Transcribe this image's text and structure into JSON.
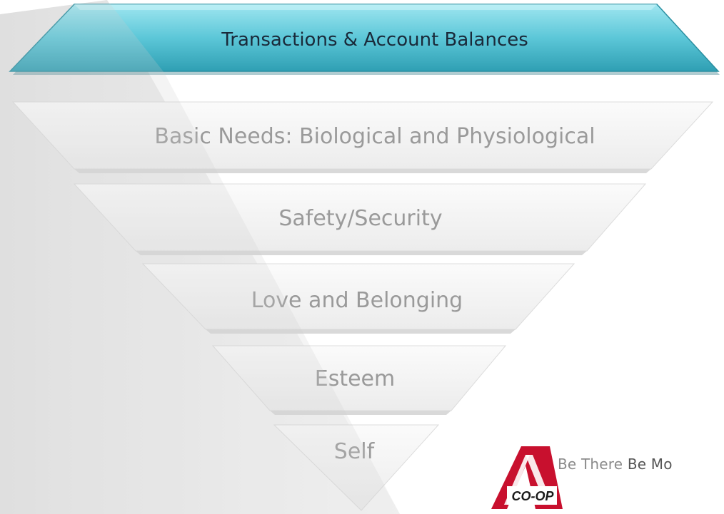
{
  "header": {
    "title": "Transactions & Account Balances",
    "fill": "#5cc7d8",
    "text_color": "#1a2a3a"
  },
  "pyramid": {
    "tiers": [
      {
        "label": "Basic Needs: Biological and Physiological"
      },
      {
        "label": "Safety/Security"
      },
      {
        "label": "Love and Belonging"
      },
      {
        "label": "Esteem"
      },
      {
        "label": "Self"
      }
    ],
    "tier_fill": "#f2f2f2",
    "label_color": "#9a9a9a"
  },
  "logo": {
    "wordmark": "CO-OP",
    "tagline_part1": "Be There ",
    "tagline_part2": "Be Mo",
    "brand_color": "#c8102e"
  }
}
